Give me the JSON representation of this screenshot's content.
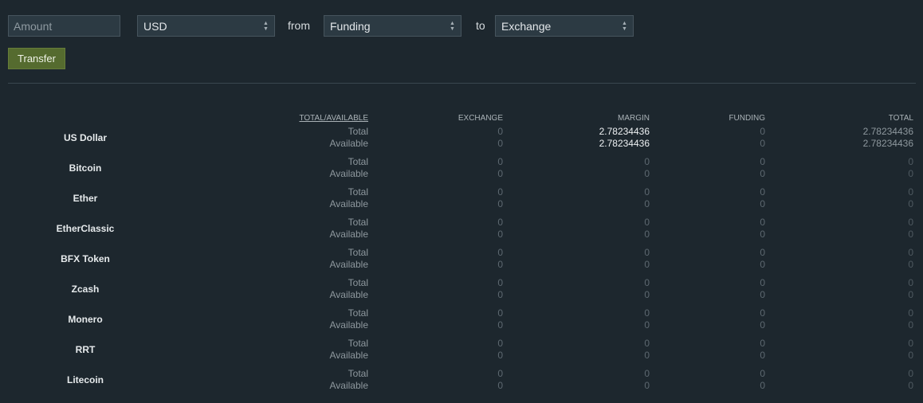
{
  "form": {
    "amount_placeholder": "Amount",
    "currency_value": "USD",
    "from_label": "from",
    "from_value": "Funding",
    "to_label": "to",
    "to_value": "Exchange",
    "transfer_label": "Transfer"
  },
  "table": {
    "headers": [
      "TOTAL/AVAILABLE",
      "EXCHANGE",
      "MARGIN",
      "FUNDING",
      "TOTAL"
    ],
    "row_labels": {
      "total": "Total",
      "available": "Available"
    },
    "currencies": [
      {
        "name": "US Dollar",
        "total": {
          "exchange": "0",
          "margin": "2.78234436",
          "funding": "0",
          "total": "2.78234436"
        },
        "available": {
          "exchange": "0",
          "margin": "2.78234436",
          "funding": "0",
          "total": "2.78234436"
        }
      },
      {
        "name": "Bitcoin",
        "total": {
          "exchange": "0",
          "margin": "0",
          "funding": "0",
          "total": "0"
        },
        "available": {
          "exchange": "0",
          "margin": "0",
          "funding": "0",
          "total": "0"
        }
      },
      {
        "name": "Ether",
        "total": {
          "exchange": "0",
          "margin": "0",
          "funding": "0",
          "total": "0"
        },
        "available": {
          "exchange": "0",
          "margin": "0",
          "funding": "0",
          "total": "0"
        }
      },
      {
        "name": "EtherClassic",
        "total": {
          "exchange": "0",
          "margin": "0",
          "funding": "0",
          "total": "0"
        },
        "available": {
          "exchange": "0",
          "margin": "0",
          "funding": "0",
          "total": "0"
        }
      },
      {
        "name": "BFX Token",
        "total": {
          "exchange": "0",
          "margin": "0",
          "funding": "0",
          "total": "0"
        },
        "available": {
          "exchange": "0",
          "margin": "0",
          "funding": "0",
          "total": "0"
        }
      },
      {
        "name": "Zcash",
        "total": {
          "exchange": "0",
          "margin": "0",
          "funding": "0",
          "total": "0"
        },
        "available": {
          "exchange": "0",
          "margin": "0",
          "funding": "0",
          "total": "0"
        }
      },
      {
        "name": "Monero",
        "total": {
          "exchange": "0",
          "margin": "0",
          "funding": "0",
          "total": "0"
        },
        "available": {
          "exchange": "0",
          "margin": "0",
          "funding": "0",
          "total": "0"
        }
      },
      {
        "name": "RRT",
        "total": {
          "exchange": "0",
          "margin": "0",
          "funding": "0",
          "total": "0"
        },
        "available": {
          "exchange": "0",
          "margin": "0",
          "funding": "0",
          "total": "0"
        }
      },
      {
        "name": "Litecoin",
        "total": {
          "exchange": "0",
          "margin": "0",
          "funding": "0",
          "total": "0"
        },
        "available": {
          "exchange": "0",
          "margin": "0",
          "funding": "0",
          "total": "0"
        }
      }
    ]
  }
}
